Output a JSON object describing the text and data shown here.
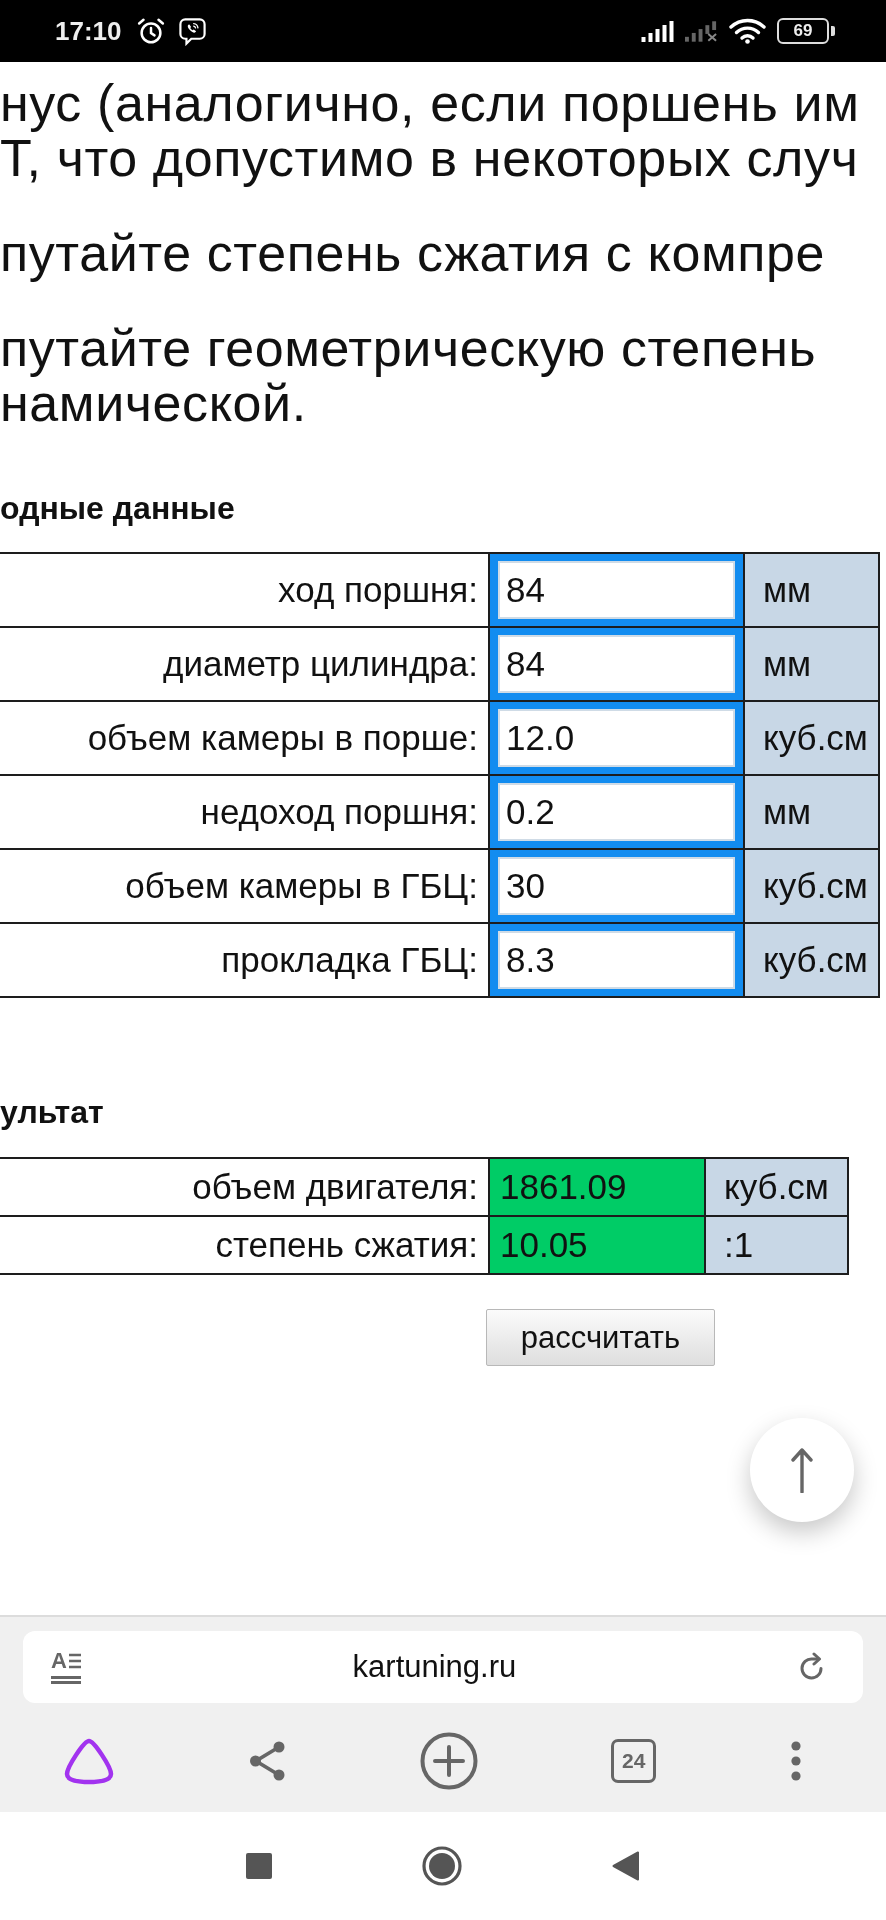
{
  "status_bar": {
    "time": "17:10",
    "battery": "69"
  },
  "article": {
    "paragraphs": [
      {
        "lines": [
          "нус (аналогично, если поршень им",
          "Т, что допустимо в некоторых случ"
        ]
      },
      {
        "lines": [
          "путайте степень сжатия с компре"
        ]
      },
      {
        "lines": [
          "путайте геометрическую степень",
          "намической."
        ]
      }
    ]
  },
  "input_section": {
    "heading": "одные данные",
    "rows": [
      {
        "label": "ход поршня:",
        "value": "84",
        "unit": "мм"
      },
      {
        "label": "диаметр цилиндра:",
        "value": "84",
        "unit": "мм"
      },
      {
        "label": "объем камеры в порше:",
        "value": "12.0",
        "unit": "куб.см"
      },
      {
        "label": "недоход поршня:",
        "value": "0.2",
        "unit": "мм"
      },
      {
        "label": "объем камеры в ГБЦ:",
        "value": "30",
        "unit": "куб.см"
      },
      {
        "label": "прокладка ГБЦ:",
        "value": "8.3",
        "unit": "куб.см"
      }
    ]
  },
  "result_section": {
    "heading": "ультат",
    "rows": [
      {
        "label": "объем двигателя:",
        "value": "1861.09",
        "unit": "куб.см"
      },
      {
        "label": "степень сжатия:",
        "value": "10.05",
        "unit": ":1"
      }
    ]
  },
  "calculate_button": {
    "label": "рассчитать"
  },
  "browser": {
    "reader_label": "A",
    "url": "kartuning.ru",
    "tab_count": "24"
  }
}
